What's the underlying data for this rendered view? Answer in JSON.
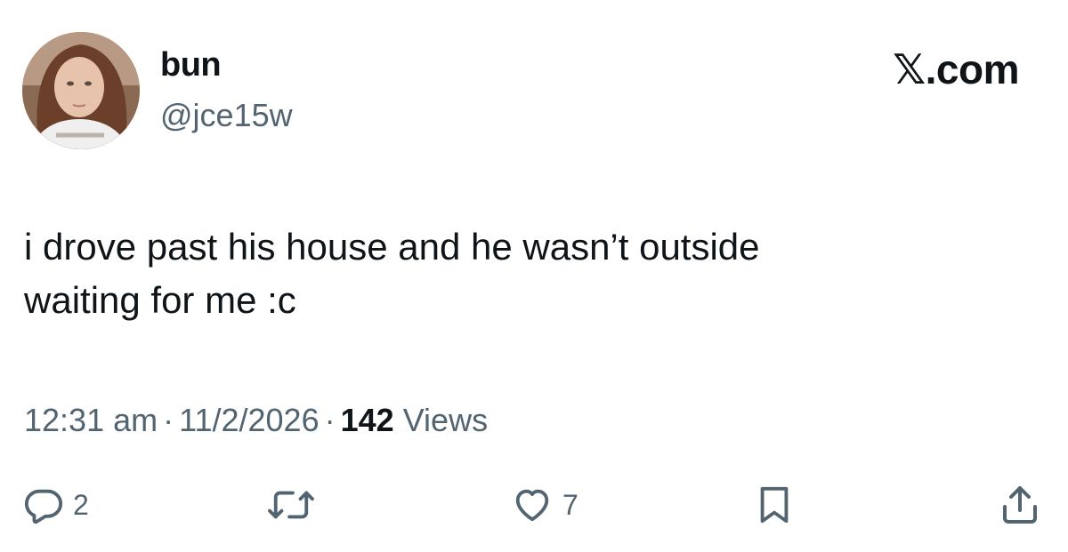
{
  "author": {
    "display_name": "bun",
    "handle": "@jce15w"
  },
  "brand": "𝕏.com",
  "tweet": {
    "text_line1": "i drove past his house and he wasn’t outside",
    "text_line2": "waiting for me :c"
  },
  "meta": {
    "time": "12:31 am",
    "separator": "·",
    "date": "11/2/2026",
    "views_count": "142",
    "views_label": "Views"
  },
  "actions": {
    "reply_icon": "reply-icon",
    "reply_count": "2",
    "retweet_icon": "retweet-icon",
    "like_icon": "heart-icon",
    "like_count": "7",
    "bookmark_icon": "bookmark-icon",
    "share_icon": "share-icon"
  },
  "colors": {
    "text_primary": "#0f1419",
    "text_secondary": "#536471",
    "background": "#ffffff"
  }
}
